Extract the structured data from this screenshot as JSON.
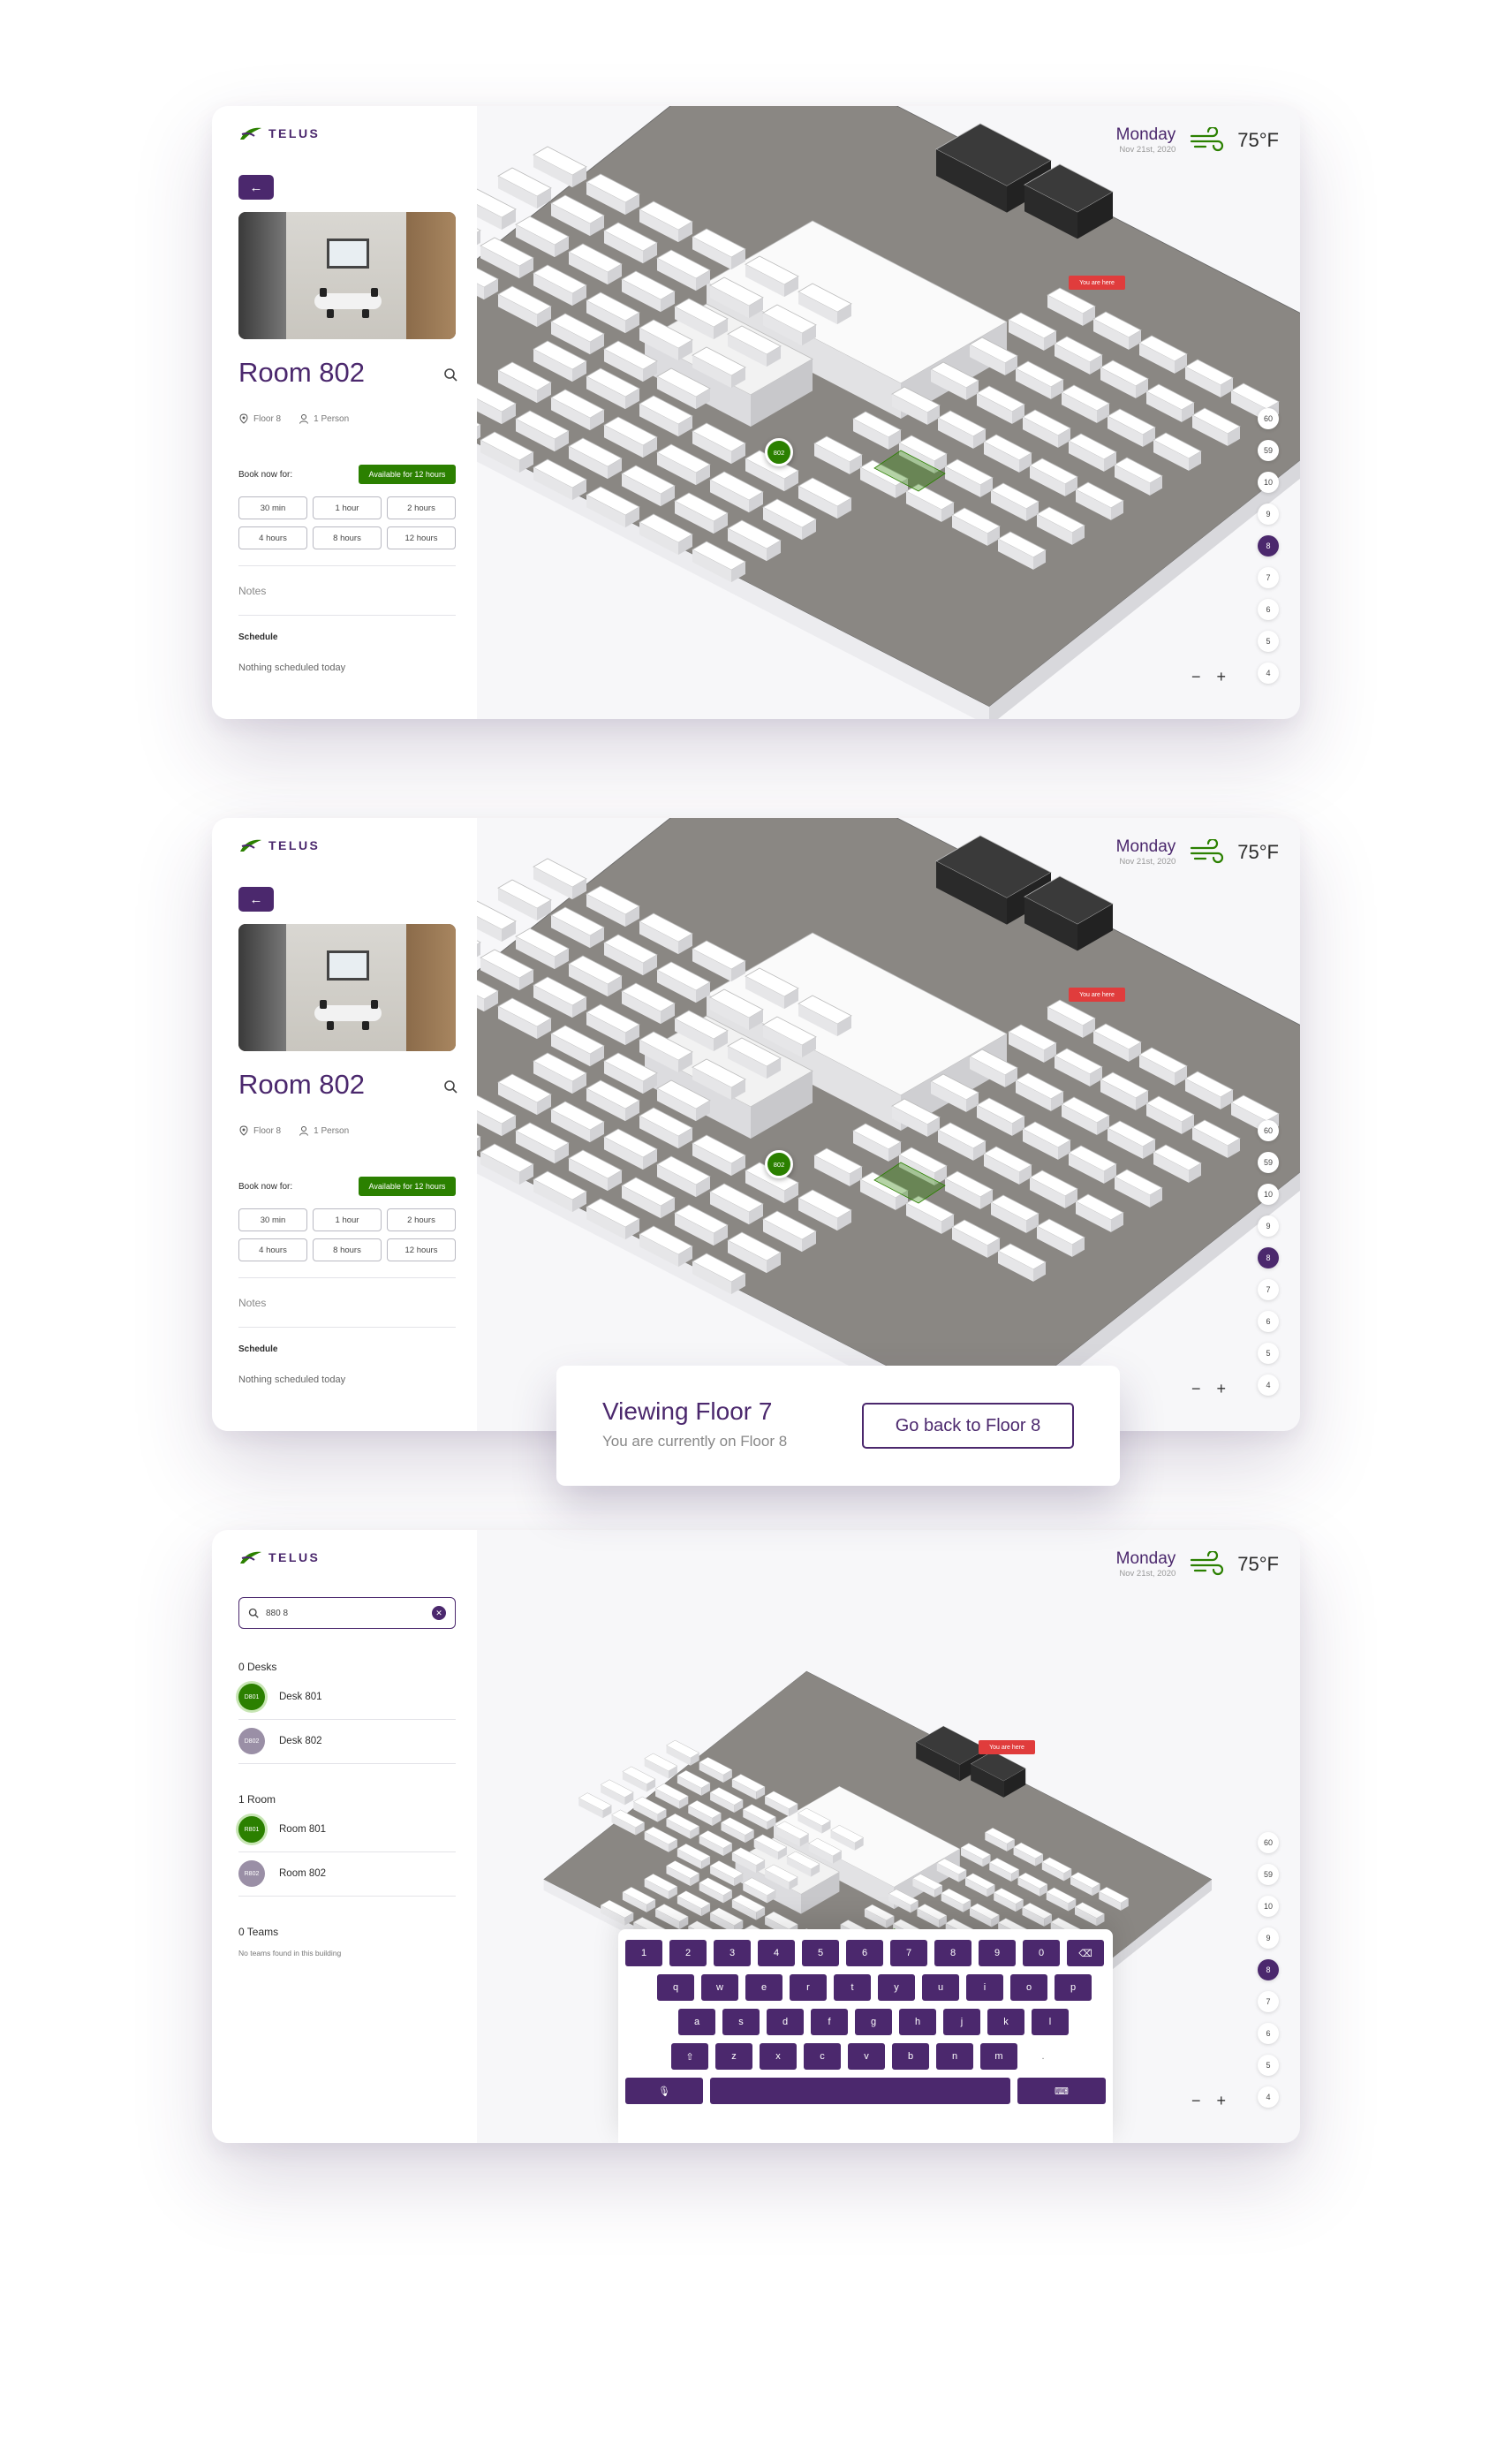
{
  "brand": {
    "name": "TELUS"
  },
  "colors": {
    "primary": "#4b286d",
    "green": "#2b8000",
    "alert": "#e03c3c"
  },
  "detail": {
    "room_title": "Room 802",
    "floor": "Floor 8",
    "capacity": "1 Person",
    "book_label": "Book now for:",
    "availability": "Available for 12 hours",
    "durations": [
      "30 min",
      "1 hour",
      "2 hours",
      "4 hours",
      "8 hours",
      "12 hours"
    ],
    "notes": "Notes",
    "schedule_label": "Schedule",
    "schedule_empty": "Nothing scheduled today",
    "pin_label": "802"
  },
  "weather": {
    "day": "Monday",
    "date": "Nov 21st, 2020",
    "temp": "75°F",
    "icon": "wind-icon"
  },
  "floors": [
    "60",
    "59",
    "10",
    "9",
    "8",
    "7",
    "6",
    "5",
    "4"
  ],
  "active_floor": "8",
  "zoom": {
    "minus": "−",
    "plus": "+"
  },
  "you_are_here": "You are here",
  "toast": {
    "title": "Viewing Floor 7",
    "subtitle": "You are currently on Floor 8",
    "button": "Go back to Floor 8"
  },
  "search": {
    "query": "880 8",
    "desks_header": "0 Desks",
    "desks": [
      {
        "badge": "D801",
        "name": "Desk 801"
      },
      {
        "badge": "D802",
        "name": "Desk 802"
      }
    ],
    "rooms_header": "1 Room",
    "rooms": [
      {
        "badge": "R801",
        "name": "Room 801"
      },
      {
        "badge": "R802",
        "name": "Room 802"
      }
    ],
    "teams_header": "0 Teams",
    "teams_empty": "No teams found in this building"
  },
  "keyboard": {
    "row1": [
      "1",
      "2",
      "3",
      "4",
      "5",
      "6",
      "7",
      "8",
      "9",
      "0"
    ],
    "row2": [
      "q",
      "w",
      "e",
      "r",
      "t",
      "y",
      "u",
      "i",
      "o",
      "p"
    ],
    "row3": [
      "a",
      "s",
      "d",
      "f",
      "g",
      "h",
      "j",
      "k",
      "l"
    ],
    "row4": [
      "z",
      "x",
      "c",
      "v",
      "b",
      "n",
      "m"
    ]
  }
}
